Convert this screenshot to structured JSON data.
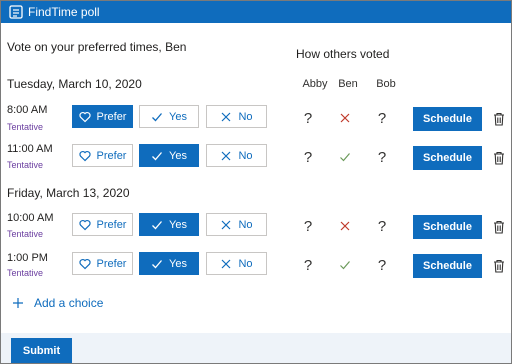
{
  "app": {
    "title": "FindTime poll"
  },
  "heading": "Vote on your preferred times, Ben",
  "others_heading": "How others voted",
  "voters": [
    "Abby",
    "Ben",
    "Bob"
  ],
  "labels": {
    "prefer": "Prefer",
    "yes": "Yes",
    "no": "No",
    "schedule": "Schedule",
    "add_choice": "Add a choice",
    "submit": "Submit"
  },
  "days": [
    {
      "date": "Tuesday, March 10, 2020",
      "slots": [
        {
          "time": "8:00 AM",
          "status": "Tentative",
          "selected": "prefer",
          "votes": [
            "unknown",
            "no",
            "unknown"
          ]
        },
        {
          "time": "11:00 AM",
          "status": "Tentative",
          "selected": "yes",
          "votes": [
            "unknown",
            "yes",
            "unknown"
          ]
        }
      ]
    },
    {
      "date": "Friday, March 13, 2020",
      "slots": [
        {
          "time": "10:00 AM",
          "status": "Tentative",
          "selected": "yes",
          "votes": [
            "unknown",
            "no",
            "unknown"
          ]
        },
        {
          "time": "1:00 PM",
          "status": "Tentative",
          "selected": "yes",
          "votes": [
            "unknown",
            "yes",
            "unknown"
          ]
        }
      ]
    }
  ],
  "vote_symbols": {
    "unknown": "?"
  },
  "colors": {
    "accent": "#0f6cbd",
    "no_mark": "#c0392b",
    "yes_mark": "#6b9a5a",
    "tentative": "#6b3fa0"
  }
}
